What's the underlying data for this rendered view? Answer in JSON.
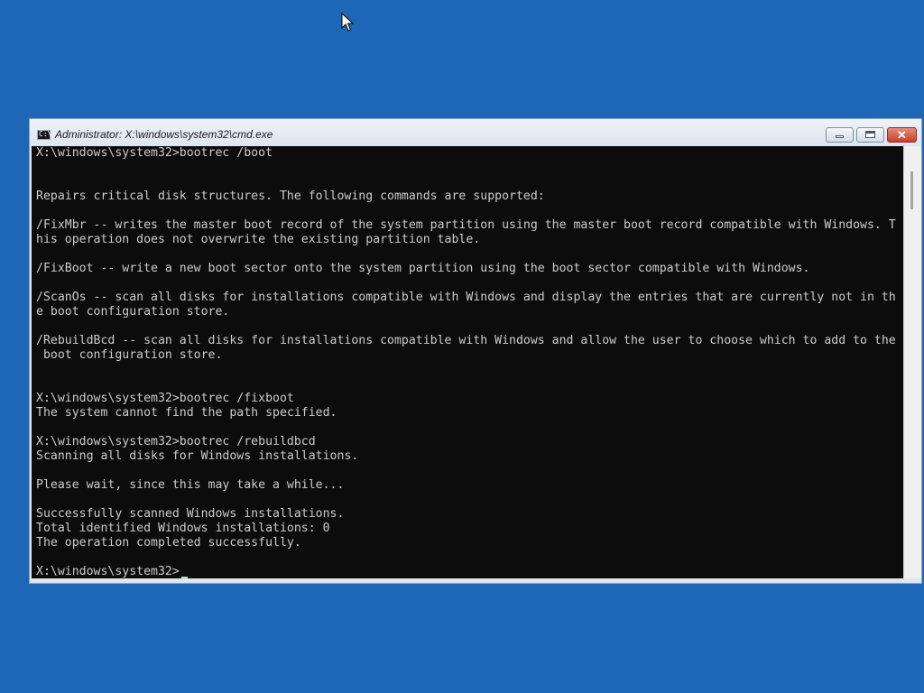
{
  "window": {
    "title": "Administrator: X:\\windows\\system32\\cmd.exe",
    "icon_glyph": "C:\\",
    "close_glyph": "✕",
    "accent_color": "#1e67b6"
  },
  "console": {
    "lines": [
      "X:\\windows\\system32>bootrec /boot",
      "",
      "",
      "Repairs critical disk structures. The following commands are supported:",
      "",
      "/FixMbr -- writes the master boot record of the system partition using the master boot record compatible with Windows. T",
      "his operation does not overwrite the existing partition table.",
      "",
      "/FixBoot -- write a new boot sector onto the system partition using the boot sector compatible with Windows.",
      "",
      "/ScanOs -- scan all disks for installations compatible with Windows and display the entries that are currently not in th",
      "e boot configuration store.",
      "",
      "/RebuildBcd -- scan all disks for installations compatible with Windows and allow the user to choose which to add to the",
      " boot configuration store.",
      "",
      "",
      "X:\\windows\\system32>bootrec /fixboot",
      "The system cannot find the path specified.",
      "",
      "X:\\windows\\system32>bootrec /rebuildbcd",
      "Scanning all disks for Windows installations.",
      "",
      "Please wait, since this may take a while...",
      "",
      "Successfully scanned Windows installations.",
      "Total identified Windows installations: 0",
      "The operation completed successfully.",
      "",
      "X:\\windows\\system32>"
    ]
  }
}
